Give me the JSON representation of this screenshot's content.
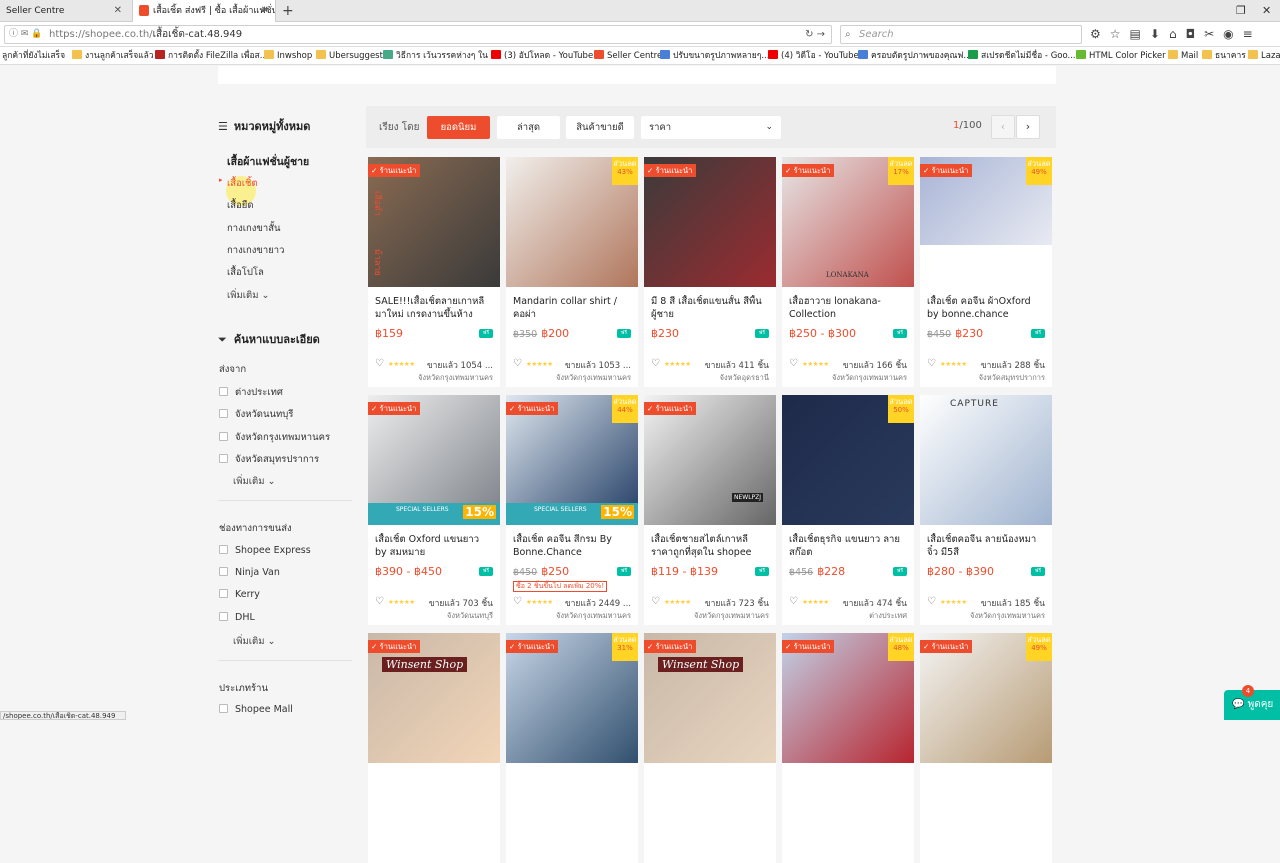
{
  "browser": {
    "tabs": [
      {
        "title": "Seller Centre"
      },
      {
        "title": "เสื้อเชิ้ต ส่งฟรี | ซื้อ เสื้อผ้าแฟชั่น"
      }
    ],
    "url_host": "https://shopee.co.th/",
    "url_path": "เสื้อเชิ้ต-cat.48.949",
    "search_placeholder": "Search",
    "bookmarks": [
      "ลูกค้าที่ยังไม่เสร็จ",
      "งานลูกค้าเสร็จแล้ว",
      "การติดตั้ง FileZilla เพื่อส...",
      "Inwshop",
      "Ubersuggest",
      "วิธีการ เว้นวรรคห่างๆ ใน ...",
      "(3) อัปโหลด - YouTube",
      "Seller Centre",
      "ปรับขนาดรูปภาพหลายๆ...",
      "(4) วิดีโอ - YouTube",
      "ครอบตัดรูปภาพของคุณฟ...",
      "สเปรดชีตไม่มีชื่อ - Goo...",
      "HTML Color Picker",
      "Mail",
      "ธนาคาร",
      "Laza"
    ],
    "status_url": "/shopee.co.th/เสื้อเชิ้ต-cat.48.949"
  },
  "sidebar": {
    "all_categories": "หมวดหมู่ทั้งหมด",
    "parent_category": "เสื้อผ้าแฟชั่นผู้ชาย",
    "categories": [
      "เสื้อเชิ้ต",
      "เสื้อยืด",
      "กางเกงขาสั้น",
      "กางเกงขายาว",
      "เสื้อโปโล"
    ],
    "more": "เพิ่มเติม",
    "filter_title": "ค้นหาแบบละเอียด",
    "ship_from_title": "ส่งจาก",
    "ship_from": [
      "ต่างประเทศ",
      "จังหวัดนนทบุรี",
      "จังหวัดกรุงเทพมหานคร",
      "จังหวัดสมุทรปราการ"
    ],
    "shipping_title": "ช่องทางการขนส่ง",
    "shipping": [
      "Shopee Express",
      "Ninja Van",
      "Kerry",
      "DHL"
    ],
    "shop_type_title": "ประเภทร้าน",
    "shop_type": [
      "Shopee Mall"
    ]
  },
  "sortbar": {
    "label": "เรียง โดย",
    "buttons": [
      "ยอดนิยม",
      "ล่าสุด",
      "สินค้าขายดี"
    ],
    "price_select": "ราคา",
    "page_current": "1",
    "page_total": "/100"
  },
  "labels": {
    "preferred": "ร้านแนะนำ",
    "discount": "ส่วนลด",
    "free": "ฟรี"
  },
  "products": [
    {
      "name": "SALE!!!เสื้อเชิ้ตลายเกาหลี มาใหม่ เกรดงานขึ้นห้าง",
      "old": "",
      "price": "฿159",
      "sold": "ขายแล้ว 1054 ...",
      "loc": "จังหวัดกรุงเทพมหานคร",
      "pref": true,
      "disc": ""
    },
    {
      "name": "Mandarin collar shirt / คอผ่า",
      "old": "฿350",
      "price": "฿200",
      "sold": "ขายแล้ว 1053 ...",
      "loc": "จังหวัดกรุงเทพมหานคร",
      "pref": false,
      "disc": "43%"
    },
    {
      "name": "มี 8 สี เสื้อเชิ้ตแขนสั้น สีพื้น ผู้ชาย",
      "old": "",
      "price": "฿230",
      "sold": "ขายแล้ว 411 ชิ้น",
      "loc": "จังหวัดอุดรธานี",
      "pref": true,
      "disc": ""
    },
    {
      "name": "เสื้อฮาวาย lonakana-Collection",
      "old": "",
      "price": "฿250 - ฿300",
      "sold": "ขายแล้ว 166 ชิ้น",
      "loc": "จังหวัดกรุงเทพมหานคร",
      "pref": true,
      "disc": "17%"
    },
    {
      "name": "เสื้อเชิ้ต คอจีน ผ้าOxford by bonne.chance",
      "old": "฿450",
      "price": "฿230",
      "sold": "ขายแล้ว 288 ชิ้น",
      "loc": "จังหวัดสมุทรปราการ",
      "pref": true,
      "disc": "49%"
    },
    {
      "name": "เสื้อเชิ้ต Oxford แขนยาว by สมหมาย",
      "old": "",
      "price": "฿390 - ฿450",
      "sold": "ขายแล้ว 703 ชิ้น",
      "loc": "จังหวัดนนทบุรี",
      "pref": true,
      "disc": ""
    },
    {
      "name": "เสื้อเชิ้ต คอจีน สีกรม By Bonne.Chance",
      "old": "฿450",
      "price": "฿250",
      "promo": "ซื้อ 2 ชิ้นขึ้นไป ลดเพิ่ม 20%!",
      "sold": "ขายแล้ว 2449 ...",
      "loc": "จังหวัดกรุงเทพมหานคร",
      "pref": true,
      "disc": "44%"
    },
    {
      "name": "เสื้อเชิ้ตชายสไตล์เกาหลี ราคาถูกที่สุดใน shopee",
      "old": "",
      "price": "฿119 - ฿139",
      "sold": "ขายแล้ว 723 ชิ้น",
      "loc": "จังหวัดกรุงเทพมหานคร",
      "pref": true,
      "disc": ""
    },
    {
      "name": "เสื้อเชิ้ตธุรกิจ แขนยาว ลายสก๊อต",
      "old": "฿456",
      "price": "฿228",
      "sold": "ขายแล้ว 474 ชิ้น",
      "loc": "ต่างประเทศ",
      "pref": false,
      "disc": "50%"
    },
    {
      "name": "เสื้อเชิ้ตคอจีน ลายน้องหมา จิ๋ว มี5สี",
      "old": "",
      "price": "฿280 - ฿390",
      "sold": "ขายแล้ว 185 ชิ้น",
      "loc": "จังหวัดกรุงเทพมหานคร",
      "pref": false,
      "disc": ""
    },
    {
      "name": "",
      "old": "",
      "price": "",
      "sold": "",
      "loc": "",
      "pref": true,
      "disc": ""
    },
    {
      "name": "",
      "old": "",
      "price": "",
      "sold": "",
      "loc": "",
      "pref": true,
      "disc": "31%"
    },
    {
      "name": "",
      "old": "",
      "price": "",
      "sold": "",
      "loc": "",
      "pref": true,
      "disc": ""
    },
    {
      "name": "",
      "old": "",
      "price": "",
      "sold": "",
      "loc": "",
      "pref": true,
      "disc": "48%"
    },
    {
      "name": "",
      "old": "",
      "price": "",
      "sold": "",
      "loc": "",
      "pref": true,
      "disc": "49%"
    }
  ],
  "image_text": {
    "winsent": "Winsent Shop",
    "capture": "CAPTURE",
    "lonakana": "LONAKANA",
    "special": "SPECIAL SELLERS",
    "pct": "15%",
    "newlp": "NEWLPZJ",
    "brand_a": "เสือดำ",
    "brand_b": "ม้าลาย"
  },
  "chat": {
    "badge": "4",
    "label": "พูดคุย"
  },
  "colors": {
    "accent": "#ee4d2d",
    "star": "#ffce3d",
    "freeship": "#00bfa5",
    "discount": "#ffd424"
  }
}
